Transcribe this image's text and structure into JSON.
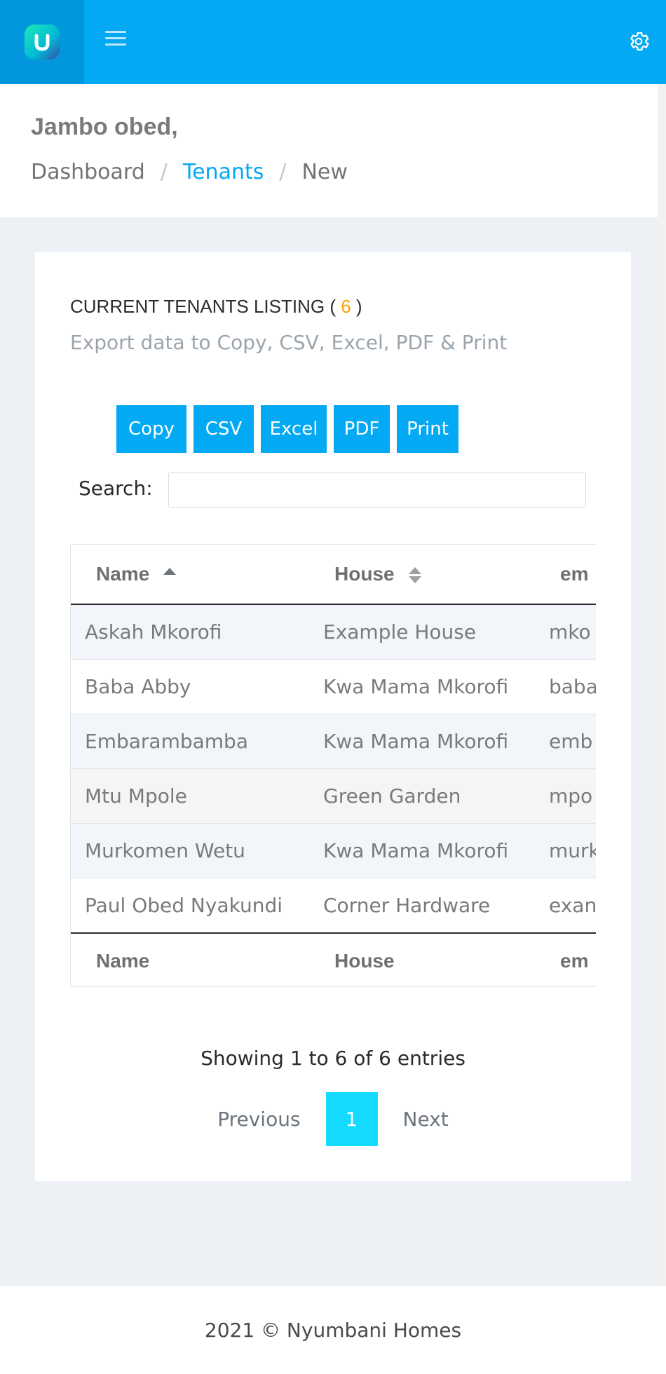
{
  "header": {
    "brand_icon": "nyumbani-logo",
    "menu_icon": "hamburger-icon",
    "settings_icon": "gear-icon"
  },
  "page": {
    "greeting": "Jambo obed,",
    "breadcrumb": [
      "Dashboard",
      "Tenants",
      "New"
    ]
  },
  "card": {
    "title": "CURRENT TENANTS LISTING",
    "count": "6",
    "subtitle": "Export data to Copy, CSV, Excel, PDF & Print",
    "buttons": [
      "Copy",
      "CSV",
      "Excel",
      "PDF",
      "Print"
    ],
    "search_label": "Search:",
    "search_value": ""
  },
  "table": {
    "columns": [
      "Name",
      "House",
      "em"
    ],
    "rows": [
      [
        "Askah Mkorofi",
        "Example House",
        "mko"
      ],
      [
        "Baba Abby",
        "Kwa Mama Mkorofi",
        "baba"
      ],
      [
        "Embarambamba",
        "Kwa Mama Mkorofi",
        "emb"
      ],
      [
        "Mtu Mpole",
        "Green Garden",
        "mpo"
      ],
      [
        "Murkomen Wetu",
        "Kwa Mama Mkorofi",
        "murk"
      ],
      [
        "Paul Obed Nyakundi",
        "Corner Hardware",
        "exan"
      ]
    ]
  },
  "pagination": {
    "info": "Showing 1 to 6 of 6 entries",
    "previous": "Previous",
    "current": "1",
    "next": "Next"
  },
  "footer": {
    "text": "2021 © Nyumbani Homes"
  },
  "colors": {
    "accent": "#03a9f3",
    "count": "#f8a100",
    "active_page": "#13dafe"
  }
}
